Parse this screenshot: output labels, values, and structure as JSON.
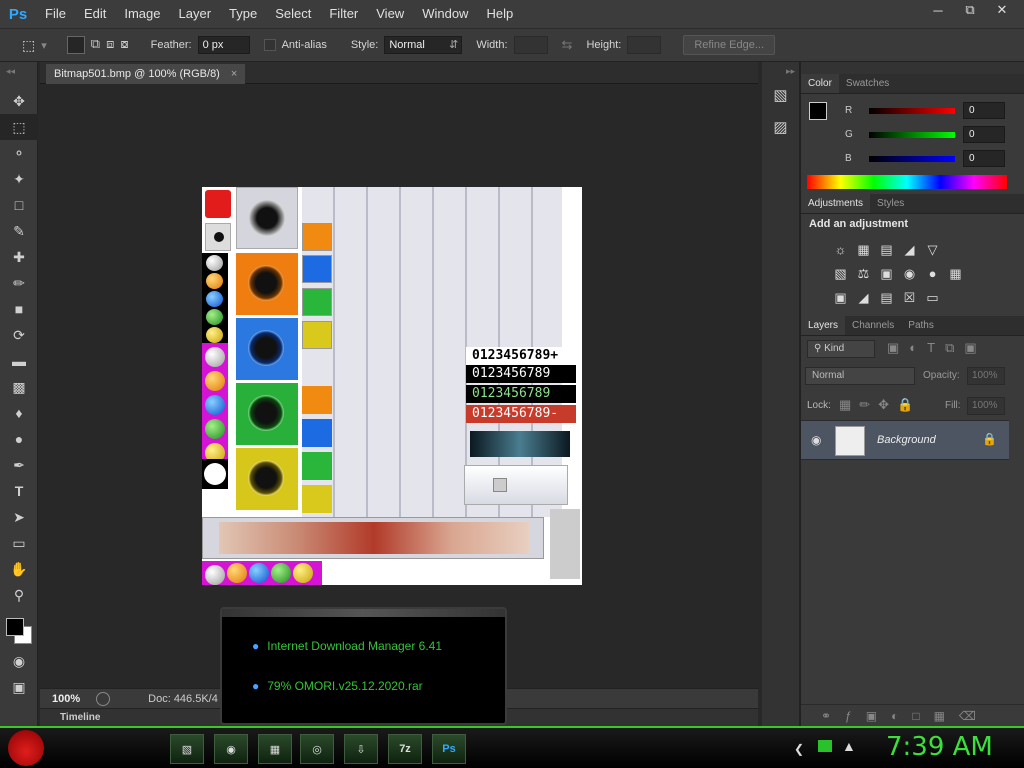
{
  "app": {
    "logo": "Ps"
  },
  "menu": [
    "File",
    "Edit",
    "Image",
    "Layer",
    "Type",
    "Select",
    "Filter",
    "View",
    "Window",
    "Help"
  ],
  "options": {
    "feather_label": "Feather:",
    "feather_value": "0 px",
    "antialias_label": "Anti-alias",
    "style_label": "Style:",
    "style_value": "Normal",
    "width_label": "Width:",
    "height_label": "Height:",
    "refine_edge": "Refine Edge..."
  },
  "document": {
    "tab_title": "Bitmap501.bmp @ 100% (RGB/8)",
    "tab_close": "×",
    "zoom": "100%",
    "doc_info": "Doc: 446.5K/4",
    "timeline": "Timeline"
  },
  "artwork_digits": [
    "0123456789+",
    "0123456789",
    "0123456789",
    "0123456789-"
  ],
  "color_panel": {
    "tabs": [
      "Color",
      "Swatches"
    ],
    "r_label": "R",
    "r_value": "0",
    "g_label": "G",
    "g_value": "0",
    "b_label": "B",
    "b_value": "0"
  },
  "adjust_panel": {
    "tabs": [
      "Adjustments",
      "Styles"
    ],
    "heading": "Add an adjustment"
  },
  "layers_panel": {
    "tabs": [
      "Layers",
      "Channels",
      "Paths"
    ],
    "filter": "Kind",
    "blend_mode": "Normal",
    "opacity_label": "Opacity:",
    "opacity_value": "100%",
    "lock_label": "Lock:",
    "fill_label": "Fill:",
    "fill_value": "100%",
    "layer_name": "Background"
  },
  "idm_popup": {
    "line1": "Internet Download Manager 6.41",
    "line2": "79% OMORI.v25.12.2020.rar"
  },
  "taskbar": {
    "clock": "7:39 AM",
    "app_7z": "7z",
    "app_ps": "Ps"
  },
  "colors": {
    "accent_green": "#38c924",
    "ps_blue": "#31a8ff",
    "layer_selected": "#4d5563"
  }
}
